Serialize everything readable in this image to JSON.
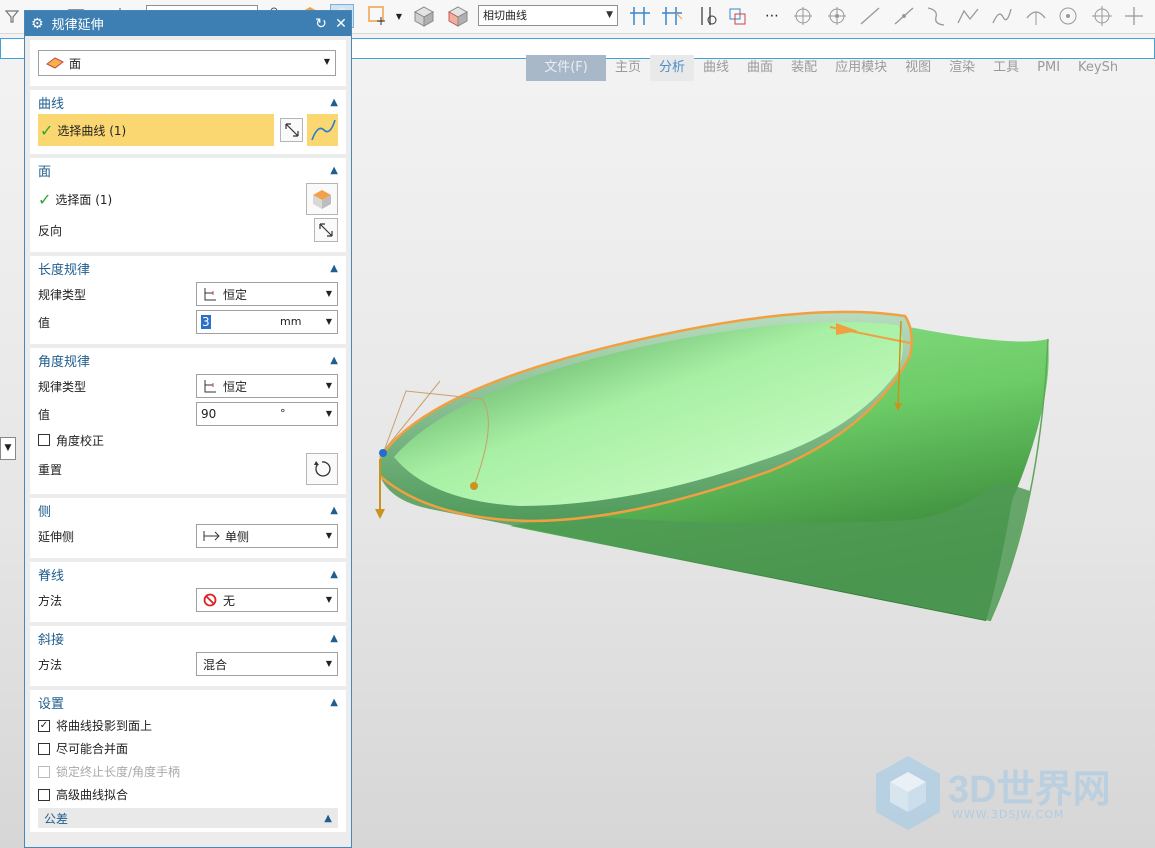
{
  "toolbar": {
    "curve_type_select": "相切曲线",
    "overflow": "⋯"
  },
  "ribbon": {
    "tabs": [
      "文件(F)",
      "主页",
      "分析",
      "曲线",
      "曲面",
      "装配",
      "应用模块",
      "视图",
      "渲染",
      "工具",
      "PMI",
      "KeySh"
    ],
    "active_tab": "分析"
  },
  "dialog": {
    "title": "规律延伸",
    "type_value": "面",
    "curve": {
      "title": "曲线",
      "select_label": "选择曲线 (1)"
    },
    "face": {
      "title": "面",
      "select_label": "选择面 (1)",
      "reverse_label": "反向"
    },
    "length_law": {
      "title": "长度规律",
      "type_label": "规律类型",
      "type_value": "恒定",
      "value_label": "值",
      "value": "3",
      "unit": "mm"
    },
    "angle_law": {
      "title": "角度规律",
      "type_label": "规律类型",
      "type_value": "恒定",
      "value_label": "值",
      "value": "90",
      "unit": "°",
      "correct_label": "角度校正",
      "reset_label": "重置"
    },
    "side": {
      "title": "侧",
      "extend_label": "延伸侧",
      "extend_value": "单侧"
    },
    "spine": {
      "title": "脊线",
      "method_label": "方法",
      "method_value": "无"
    },
    "miter": {
      "title": "斜接",
      "method_label": "方法",
      "method_value": "混合"
    },
    "settings": {
      "title": "设置",
      "opt1": "将曲线投影到面上",
      "opt2": "尽可能合并面",
      "opt3": "锁定终止长度/角度手柄",
      "opt4": "高级曲线拟合",
      "tolerance": "公差"
    }
  },
  "watermark": {
    "title": "3D世界网",
    "url": "WWW.3DSJW.COM"
  },
  "colors": {
    "title_bar": "#3d7fb2",
    "section_title": "#1f5e8e",
    "highlight": "#fbd771",
    "surface_green": "#7ed87a",
    "edge_orange": "#f0a040"
  }
}
